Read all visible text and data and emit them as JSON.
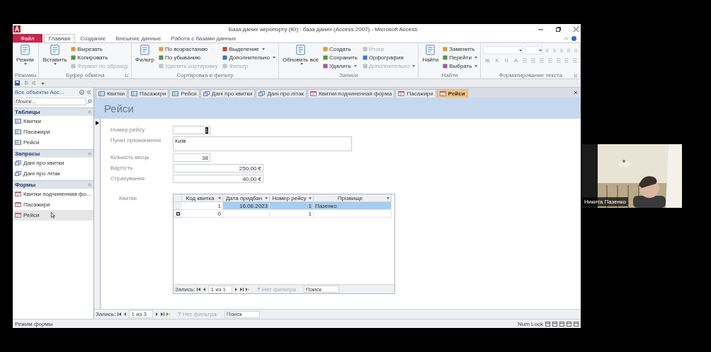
{
  "window": {
    "title": "База даних аеропорту (Ю) : база даних (Access 2007)  -  Microsoft Access"
  },
  "ribbon": {
    "tabs": [
      {
        "label": "Файл",
        "kind": "file",
        "selected": false
      },
      {
        "label": "Главная",
        "kind": "tab",
        "selected": true
      },
      {
        "label": "Создание",
        "kind": "tab",
        "selected": false
      },
      {
        "label": "Внешние данные",
        "kind": "tab",
        "selected": false
      },
      {
        "label": "Работа с базами данных",
        "kind": "tab",
        "selected": false
      }
    ],
    "groups": [
      {
        "name": "Режимы",
        "kind": "commands",
        "launcher": false,
        "items": [
          {
            "label": "Режим",
            "kind": "large",
            "dropdown": true,
            "disabled": false
          }
        ]
      },
      {
        "name": "Буфер обмена",
        "kind": "commands",
        "launcher": true,
        "items": [
          {
            "label": "Вставить",
            "kind": "large",
            "dropdown": true,
            "disabled": false
          },
          {
            "label": "Вырезать",
            "kind": "small",
            "dropdown": false,
            "disabled": false
          },
          {
            "label": "Копировать",
            "kind": "small",
            "dropdown": false,
            "disabled": false
          },
          {
            "label": "Формат по образцу",
            "kind": "small",
            "dropdown": false,
            "disabled": true
          }
        ]
      },
      {
        "name": "Сортировка и фильтр",
        "kind": "commands",
        "launcher": false,
        "items": [
          {
            "label": "Фильтр",
            "kind": "large",
            "dropdown": false,
            "disabled": false
          },
          {
            "label": "По возрастанию",
            "kind": "small",
            "dropdown": false,
            "disabled": false
          },
          {
            "label": "По убыванию",
            "kind": "small",
            "dropdown": false,
            "disabled": false
          },
          {
            "label": "Удалить сортировку",
            "kind": "small",
            "dropdown": false,
            "disabled": true
          },
          {
            "label": "Выделение",
            "kind": "small",
            "dropdown": true,
            "disabled": false
          },
          {
            "label": "Дополнительно",
            "kind": "small",
            "dropdown": true,
            "disabled": false
          },
          {
            "label": "Фильтр",
            "kind": "small",
            "dropdown": false,
            "disabled": true
          }
        ]
      },
      {
        "name": "Записи",
        "kind": "commands",
        "launcher": false,
        "items": [
          {
            "label": "Обновить все",
            "kind": "large",
            "dropdown": true,
            "disabled": false
          },
          {
            "label": "Создать",
            "kind": "small",
            "dropdown": false,
            "disabled": false
          },
          {
            "label": "Сохранить",
            "kind": "small",
            "dropdown": false,
            "disabled": false
          },
          {
            "label": "Удалить",
            "kind": "small",
            "dropdown": true,
            "disabled": false
          },
          {
            "label": "Итоги",
            "kind": "small",
            "dropdown": false,
            "disabled": true
          },
          {
            "label": "Орфография",
            "kind": "small",
            "dropdown": false,
            "disabled": false
          },
          {
            "label": "Дополнительно",
            "kind": "small",
            "dropdown": true,
            "disabled": true
          }
        ]
      },
      {
        "name": "Найти",
        "kind": "commands",
        "launcher": false,
        "items": [
          {
            "label": "Найти",
            "kind": "large",
            "dropdown": false,
            "disabled": false
          },
          {
            "label": "Заменить",
            "kind": "small",
            "dropdown": false,
            "disabled": false
          },
          {
            "label": "Перейти",
            "kind": "small",
            "dropdown": true,
            "disabled": false
          },
          {
            "label": "Выбрать",
            "kind": "small",
            "dropdown": true,
            "disabled": false
          }
        ]
      },
      {
        "name": "Форматирование текста",
        "kind": "format",
        "launcher": true,
        "buttons": [
          "Ж",
          "К",
          "Ч",
          "A"
        ]
      }
    ]
  },
  "navigation": {
    "title": "Все объекты Acc...",
    "search": {
      "placeholder": "Поиск..."
    },
    "groups": [
      {
        "name": "Таблицы",
        "kind": "table",
        "items": [
          {
            "label": "Квитки",
            "selected": false
          },
          {
            "label": "Пасажири",
            "selected": false
          },
          {
            "label": "Рейси",
            "selected": false
          }
        ]
      },
      {
        "name": "Запросы",
        "kind": "query",
        "items": [
          {
            "label": "Дані про квитки",
            "selected": false
          },
          {
            "label": "Дані про літак",
            "selected": false
          }
        ]
      },
      {
        "name": "Формы",
        "kind": "form",
        "items": [
          {
            "label": "Квитки подчиненная фо...",
            "selected": false
          },
          {
            "label": "Пасажири",
            "selected": false
          },
          {
            "label": "Рейси",
            "selected": true
          }
        ]
      }
    ]
  },
  "document_tabs": [
    {
      "label": "Квитки",
      "kind": "table",
      "selected": false
    },
    {
      "label": "Пасажири",
      "kind": "table",
      "selected": false
    },
    {
      "label": "Рейси",
      "kind": "table",
      "selected": false
    },
    {
      "label": "Дані про квитки",
      "kind": "query",
      "selected": false
    },
    {
      "label": "Дані про літак",
      "kind": "query",
      "selected": false
    },
    {
      "label": "Квитки подчиненная форма",
      "kind": "form",
      "selected": false
    },
    {
      "label": "Пасажири",
      "kind": "form",
      "selected": false
    },
    {
      "label": "Рейси",
      "kind": "form",
      "selected": true
    }
  ],
  "form": {
    "title": "Рейси",
    "fields": [
      {
        "label": "Номер рейсу",
        "value": "1",
        "kind": "short",
        "selected": true
      },
      {
        "label": "Пункт призначення",
        "value": "Київ",
        "kind": "wide",
        "selected": false
      },
      {
        "label": "Кількість місць",
        "value": "38",
        "kind": "short",
        "selected": false
      },
      {
        "label": "Вартість",
        "value": "250,00 €",
        "kind": "medium",
        "selected": false
      },
      {
        "label": "Страхування",
        "value": "40,00 €",
        "kind": "medium",
        "selected": false
      }
    ],
    "subform": {
      "label": "Квитки",
      "columns": [
        "Код квитка",
        "Дата придбан",
        "Номер рейсу",
        "Прізвище"
      ],
      "rows": [
        {
          "cells": [
            "1",
            "16.06.2023",
            "1",
            "Пазенко"
          ],
          "selected": true,
          "new_record": false
        },
        {
          "cells": [
            "0",
            "",
            "1",
            ""
          ],
          "selected": false,
          "new_record": true
        }
      ],
      "record_nav": {
        "label": "Запись:",
        "position": "1 из 1",
        "filter": "Нет фильтра",
        "search_placeholder": "Поиск"
      }
    },
    "record_nav": {
      "label": "Запись:",
      "position": "1 из 3",
      "filter": "Нет фильтра",
      "search_placeholder": "Поиск"
    }
  },
  "status_bar": {
    "mode": "Режим формы",
    "indicator": "Num Lock"
  },
  "participant": {
    "name": "Никита Пазенко"
  }
}
